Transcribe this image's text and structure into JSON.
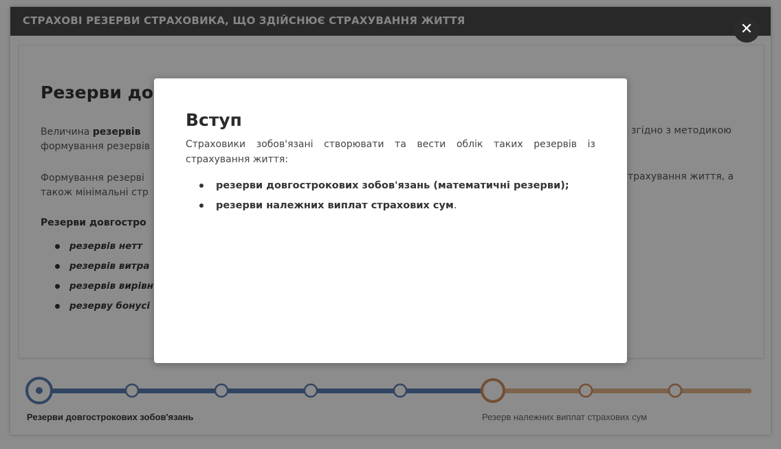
{
  "window": {
    "title": "СТРАХОВІ РЕЗЕРВИ СТРАХОВИКА, ЩО ЗДІЙСНЮЄ СТРАХУВАННЯ ЖИТТЯ",
    "close_label": "✕"
  },
  "background": {
    "heading": "Резерви дов",
    "para1_start": "Величина ",
    "para1_bold": "резервів",
    "para1_line2": "формування резервів",
    "para1_right": "згідно з методикою",
    "para2_line1": "Формування резерві",
    "para2_line2": "також мінімальні стр",
    "para2_right": "трахування життя, а",
    "bold_label": "Резерви довгостро",
    "list": [
      "резервів нетт",
      "резервів витра",
      "резервів вирівн",
      "резерву бонусі"
    ]
  },
  "modal": {
    "title": "Вступ",
    "intro": "Страховики зобов'язані створювати та вести облік таких резервів із страхування життя:",
    "items": [
      {
        "text": "резерви довгострокових зобов'язань (математичні резерви);",
        "suffix": ""
      },
      {
        "text": "резерви належних виплат страхових сум",
        "suffix": "."
      }
    ]
  },
  "progress": {
    "left_label": "Резерви довгострокових зобов'язань",
    "right_label": "Резерв належних виплат страхових сум",
    "blue_color": "#5a7fb3",
    "orange_color": "#e3b48f",
    "orange_dark": "#d48f5f",
    "steps_blue": 5,
    "steps_orange": 3,
    "active_step": 1
  }
}
